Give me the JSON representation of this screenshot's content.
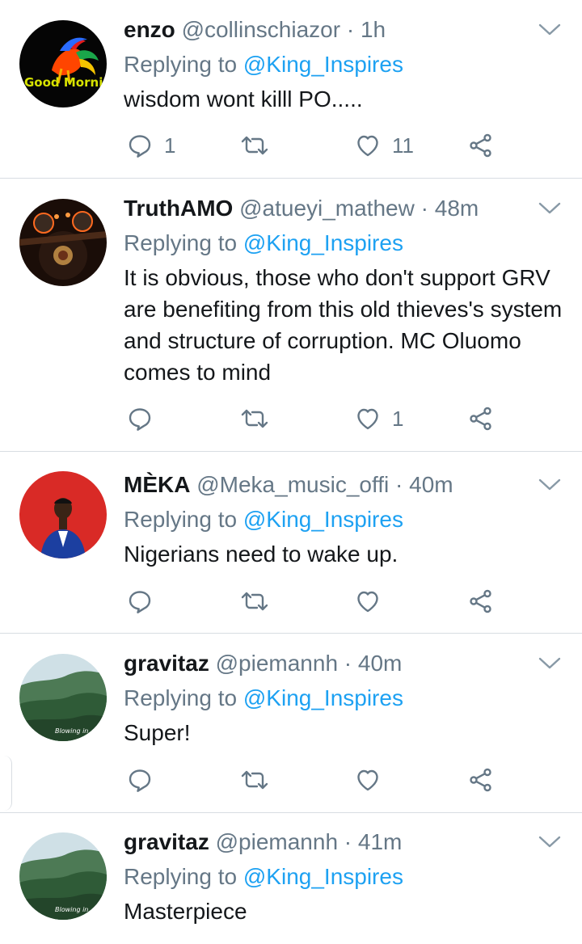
{
  "reply_prefix": "Replying to",
  "tweets": [
    {
      "name": "enzo",
      "handle": "@collinschiazor",
      "dot": "·",
      "time": "1h",
      "mention": "@King_Inspires",
      "text": "wisdom wont killl PO.....",
      "avatar_text": "Good Morning",
      "reply_count": "1",
      "retweet_count": "",
      "like_count": "11"
    },
    {
      "name": "TruthAMO",
      "handle": "@atueyi_mathew",
      "dot": "·",
      "time": "48m",
      "mention": "@King_Inspires",
      "text": "It is obvious, those who don't support GRV are benefiting from this old thieves's system and structure of corruption. MC Oluomo comes to mind",
      "reply_count": "",
      "retweet_count": "",
      "like_count": "1"
    },
    {
      "name": "MÈKA",
      "handle": "@Meka_music_offi",
      "dot": "·",
      "time": "40m",
      "mention": "@King_Inspires",
      "text": "Nigerians need to wake up.",
      "reply_count": "",
      "retweet_count": "",
      "like_count": ""
    },
    {
      "name": "gravitaz",
      "handle": "@piemannh",
      "dot": "·",
      "time": "40m",
      "mention": "@King_Inspires",
      "text": "Super!",
      "avatar_text": "Blowing in",
      "reply_count": "",
      "retweet_count": "",
      "like_count": ""
    },
    {
      "name": "gravitaz",
      "handle": "@piemannh",
      "dot": "·",
      "time": "41m",
      "mention": "@King_Inspires",
      "text": "Masterpiece",
      "avatar_text": "Blowing in",
      "reply_count": "",
      "retweet_count": "",
      "like_count": ""
    }
  ],
  "colors": {
    "link": "#1da1f2",
    "muted": "#657786",
    "text": "#14171a",
    "divider": "#d8dde2"
  }
}
